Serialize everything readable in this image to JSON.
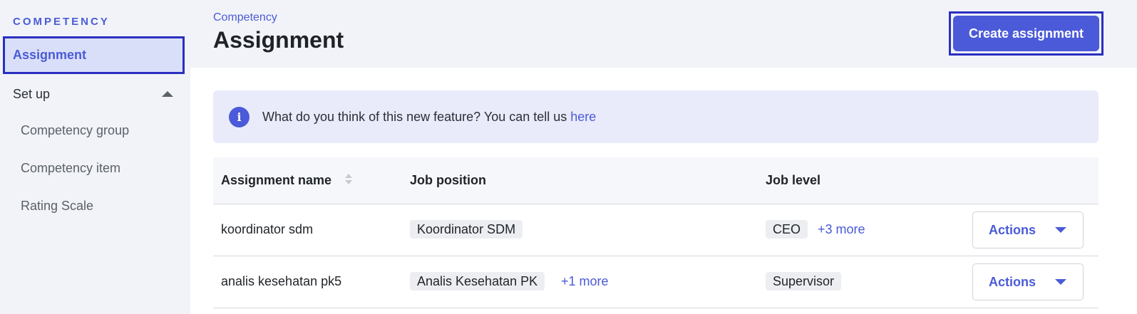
{
  "sidebar": {
    "section_label": "COMPETENCY",
    "active_item": "Assignment",
    "group_label": "Set up",
    "sub_items": [
      "Competency group",
      "Competency item",
      "Rating Scale"
    ]
  },
  "header": {
    "breadcrumb": "Competency",
    "title": "Assignment",
    "create_button": "Create assignment"
  },
  "banner": {
    "text": "What do you think of this new feature? You can tell us ",
    "link": "here",
    "icon": "info-icon"
  },
  "table": {
    "columns": [
      "Assignment name",
      "Job position",
      "Job level"
    ],
    "rows": [
      {
        "name": "koordinator sdm",
        "position": "Koordinator SDM",
        "position_more": "",
        "level": "CEO",
        "level_more": "+3 more",
        "action": "Actions"
      },
      {
        "name": "analis kesehatan pk5",
        "position": "Analis Kesehatan PK",
        "position_more": "+1 more",
        "level": "Supervisor",
        "level_more": "",
        "action": "Actions"
      }
    ]
  },
  "colors": {
    "accent": "#4b5ad8",
    "sidebar_bg": "#f1f3f8",
    "banner_bg": "#e9ebfa",
    "focus_outline": "#2a2fbf"
  }
}
